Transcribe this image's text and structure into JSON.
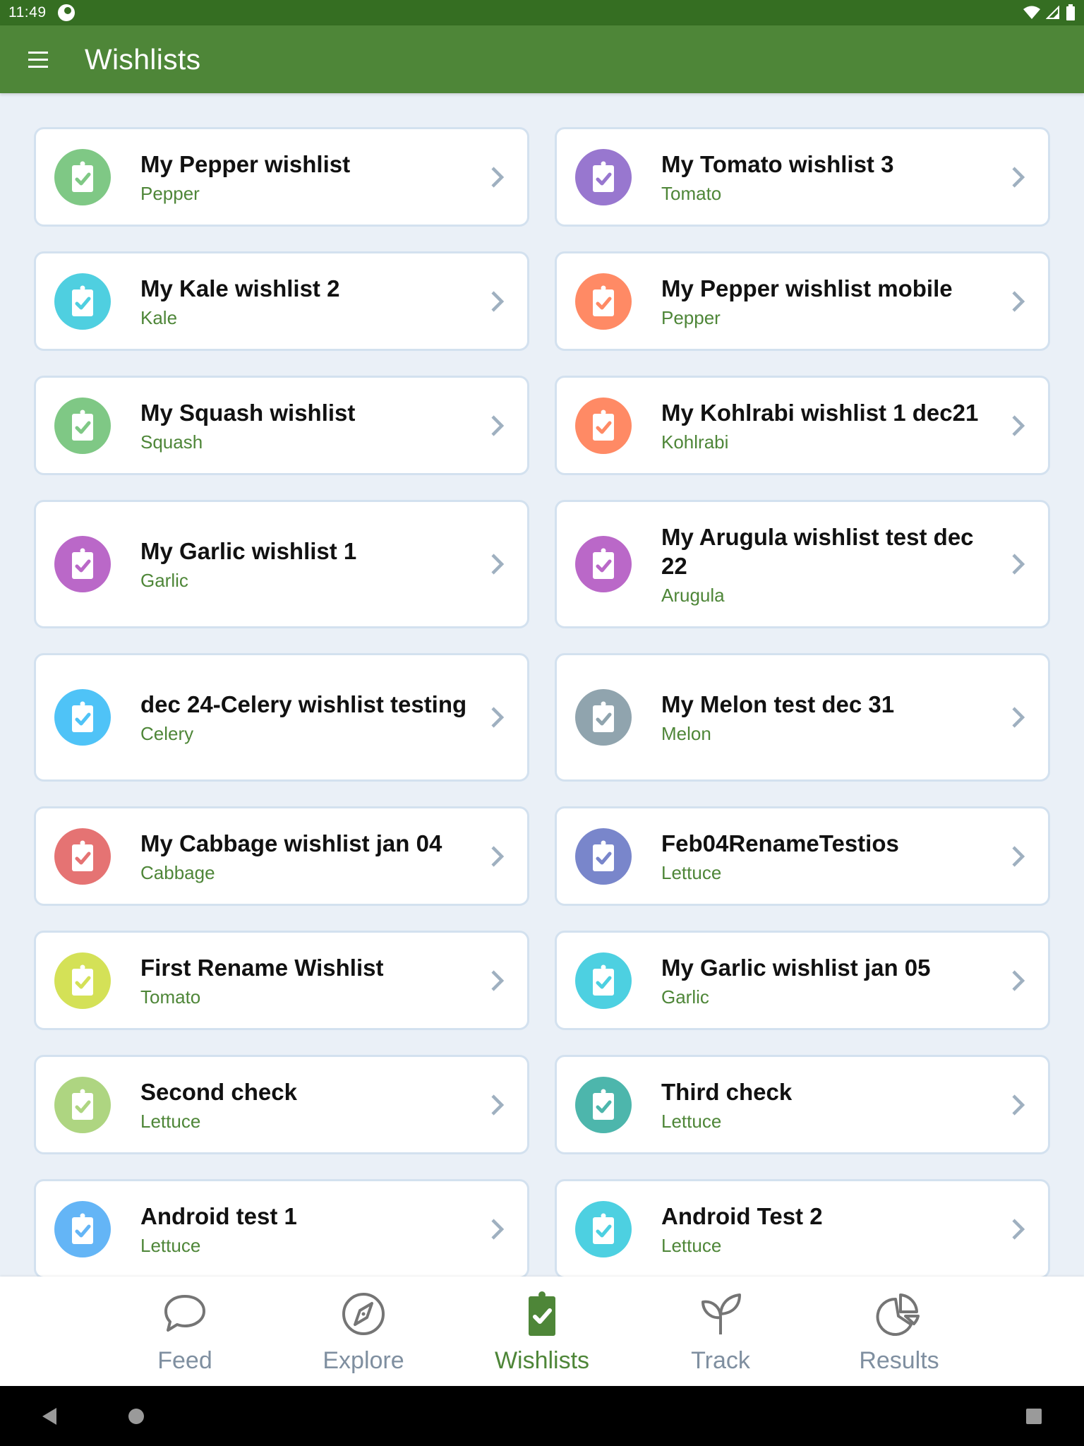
{
  "status_bar": {
    "time": "11:49"
  },
  "app_bar": {
    "title": "Wishlists"
  },
  "colors": {
    "primary": "#4e8638",
    "status_bar": "#356e22",
    "background": "#eaf0f7",
    "card_border": "#d3e1ef",
    "chevron": "#9fb0c0",
    "nav_inactive": "#7f8fa0"
  },
  "wishlists": [
    {
      "title": "My Pepper wishlist",
      "crop": "Pepper",
      "color": "#7fc885",
      "tall": false
    },
    {
      "title": "My Tomato wishlist 3",
      "crop": "Tomato",
      "color": "#9877cf",
      "tall": false
    },
    {
      "title": "My Kale wishlist 2",
      "crop": "Kale",
      "color": "#4fcfe0",
      "tall": false
    },
    {
      "title": "My Pepper wishlist mobile",
      "crop": "Pepper",
      "color": "#ff8a65",
      "tall": false
    },
    {
      "title": "My Squash wishlist",
      "crop": "Squash",
      "color": "#7fc885",
      "tall": false
    },
    {
      "title": "My Kohlrabi wishlist 1 dec21",
      "crop": "Kohlrabi",
      "color": "#ff8a65",
      "tall": false
    },
    {
      "title": "My Garlic wishlist 1",
      "crop": "Garlic",
      "color": "#ba68c8",
      "tall": true
    },
    {
      "title": "My Arugula wishlist test dec 22",
      "crop": "Arugula",
      "color": "#ba68c8",
      "tall": true
    },
    {
      "title": "dec 24-Celery wishlist testing",
      "crop": "Celery",
      "color": "#4fc3f7",
      "tall": true
    },
    {
      "title": "My Melon test dec 31",
      "crop": "Melon",
      "color": "#90a4ae",
      "tall": true
    },
    {
      "title": "My Cabbage wishlist jan 04",
      "crop": "Cabbage",
      "color": "#e57373",
      "tall": false
    },
    {
      "title": "Feb04RenameTestios",
      "crop": "Lettuce",
      "color": "#7986cb",
      "tall": false
    },
    {
      "title": "First Rename Wishlist",
      "crop": "Tomato",
      "color": "#d4e157",
      "tall": false
    },
    {
      "title": "My Garlic wishlist jan 05",
      "crop": "Garlic",
      "color": "#4dd0e1",
      "tall": false
    },
    {
      "title": "Second check",
      "crop": "Lettuce",
      "color": "#aed581",
      "tall": false
    },
    {
      "title": "Third check",
      "crop": "Lettuce",
      "color": "#4db6ac",
      "tall": false
    },
    {
      "title": "Android test 1",
      "crop": "Lettuce",
      "color": "#64b5f6",
      "tall": false
    },
    {
      "title": "Android Test 2",
      "crop": "Lettuce",
      "color": "#4dd0e1",
      "tall": false
    }
  ],
  "bottom_nav": {
    "items": [
      {
        "label": "Feed",
        "icon": "chat-bubble-icon",
        "active": false
      },
      {
        "label": "Explore",
        "icon": "compass-icon",
        "active": false
      },
      {
        "label": "Wishlists",
        "icon": "clipboard-check-icon",
        "active": true
      },
      {
        "label": "Track",
        "icon": "sprout-icon",
        "active": false
      },
      {
        "label": "Results",
        "icon": "pie-chart-icon",
        "active": false
      }
    ]
  }
}
